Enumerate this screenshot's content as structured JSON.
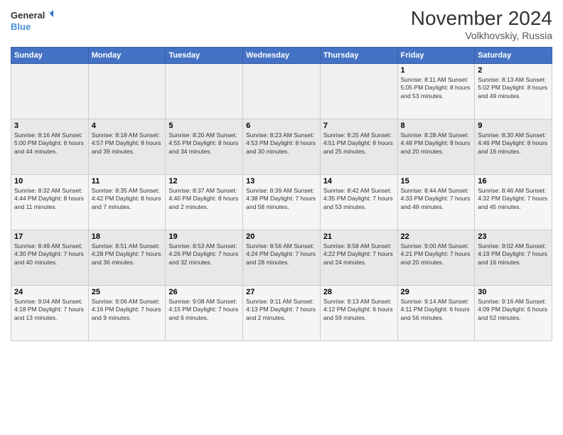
{
  "logo": {
    "line1": "General",
    "line2": "Blue"
  },
  "title": "November 2024",
  "subtitle": "Volkhovskiy, Russia",
  "days_header": [
    "Sunday",
    "Monday",
    "Tuesday",
    "Wednesday",
    "Thursday",
    "Friday",
    "Saturday"
  ],
  "weeks": [
    [
      {
        "day": "",
        "info": ""
      },
      {
        "day": "",
        "info": ""
      },
      {
        "day": "",
        "info": ""
      },
      {
        "day": "",
        "info": ""
      },
      {
        "day": "",
        "info": ""
      },
      {
        "day": "1",
        "info": "Sunrise: 8:11 AM\nSunset: 5:05 PM\nDaylight: 8 hours and 53 minutes."
      },
      {
        "day": "2",
        "info": "Sunrise: 8:13 AM\nSunset: 5:02 PM\nDaylight: 8 hours and 49 minutes."
      }
    ],
    [
      {
        "day": "3",
        "info": "Sunrise: 8:16 AM\nSunset: 5:00 PM\nDaylight: 8 hours and 44 minutes."
      },
      {
        "day": "4",
        "info": "Sunrise: 8:18 AM\nSunset: 4:57 PM\nDaylight: 8 hours and 39 minutes."
      },
      {
        "day": "5",
        "info": "Sunrise: 8:20 AM\nSunset: 4:55 PM\nDaylight: 8 hours and 34 minutes."
      },
      {
        "day": "6",
        "info": "Sunrise: 8:23 AM\nSunset: 4:53 PM\nDaylight: 8 hours and 30 minutes."
      },
      {
        "day": "7",
        "info": "Sunrise: 8:25 AM\nSunset: 4:51 PM\nDaylight: 8 hours and 25 minutes."
      },
      {
        "day": "8",
        "info": "Sunrise: 8:28 AM\nSunset: 4:48 PM\nDaylight: 8 hours and 20 minutes."
      },
      {
        "day": "9",
        "info": "Sunrise: 8:30 AM\nSunset: 4:46 PM\nDaylight: 8 hours and 16 minutes."
      }
    ],
    [
      {
        "day": "10",
        "info": "Sunrise: 8:32 AM\nSunset: 4:44 PM\nDaylight: 8 hours and 11 minutes."
      },
      {
        "day": "11",
        "info": "Sunrise: 8:35 AM\nSunset: 4:42 PM\nDaylight: 8 hours and 7 minutes."
      },
      {
        "day": "12",
        "info": "Sunrise: 8:37 AM\nSunset: 4:40 PM\nDaylight: 8 hours and 2 minutes."
      },
      {
        "day": "13",
        "info": "Sunrise: 8:39 AM\nSunset: 4:38 PM\nDaylight: 7 hours and 58 minutes."
      },
      {
        "day": "14",
        "info": "Sunrise: 8:42 AM\nSunset: 4:35 PM\nDaylight: 7 hours and 53 minutes."
      },
      {
        "day": "15",
        "info": "Sunrise: 8:44 AM\nSunset: 4:33 PM\nDaylight: 7 hours and 49 minutes."
      },
      {
        "day": "16",
        "info": "Sunrise: 8:46 AM\nSunset: 4:32 PM\nDaylight: 7 hours and 45 minutes."
      }
    ],
    [
      {
        "day": "17",
        "info": "Sunrise: 8:49 AM\nSunset: 4:30 PM\nDaylight: 7 hours and 40 minutes."
      },
      {
        "day": "18",
        "info": "Sunrise: 8:51 AM\nSunset: 4:28 PM\nDaylight: 7 hours and 36 minutes."
      },
      {
        "day": "19",
        "info": "Sunrise: 8:53 AM\nSunset: 4:26 PM\nDaylight: 7 hours and 32 minutes."
      },
      {
        "day": "20",
        "info": "Sunrise: 8:56 AM\nSunset: 4:24 PM\nDaylight: 7 hours and 28 minutes."
      },
      {
        "day": "21",
        "info": "Sunrise: 8:58 AM\nSunset: 4:22 PM\nDaylight: 7 hours and 24 minutes."
      },
      {
        "day": "22",
        "info": "Sunrise: 9:00 AM\nSunset: 4:21 PM\nDaylight: 7 hours and 20 minutes."
      },
      {
        "day": "23",
        "info": "Sunrise: 9:02 AM\nSunset: 4:19 PM\nDaylight: 7 hours and 16 minutes."
      }
    ],
    [
      {
        "day": "24",
        "info": "Sunrise: 9:04 AM\nSunset: 4:18 PM\nDaylight: 7 hours and 13 minutes."
      },
      {
        "day": "25",
        "info": "Sunrise: 9:06 AM\nSunset: 4:16 PM\nDaylight: 7 hours and 9 minutes."
      },
      {
        "day": "26",
        "info": "Sunrise: 9:08 AM\nSunset: 4:15 PM\nDaylight: 7 hours and 6 minutes."
      },
      {
        "day": "27",
        "info": "Sunrise: 9:11 AM\nSunset: 4:13 PM\nDaylight: 7 hours and 2 minutes."
      },
      {
        "day": "28",
        "info": "Sunrise: 9:13 AM\nSunset: 4:12 PM\nDaylight: 6 hours and 59 minutes."
      },
      {
        "day": "29",
        "info": "Sunrise: 9:14 AM\nSunset: 4:11 PM\nDaylight: 6 hours and 56 minutes."
      },
      {
        "day": "30",
        "info": "Sunrise: 9:16 AM\nSunset: 4:09 PM\nDaylight: 6 hours and 52 minutes."
      }
    ]
  ]
}
